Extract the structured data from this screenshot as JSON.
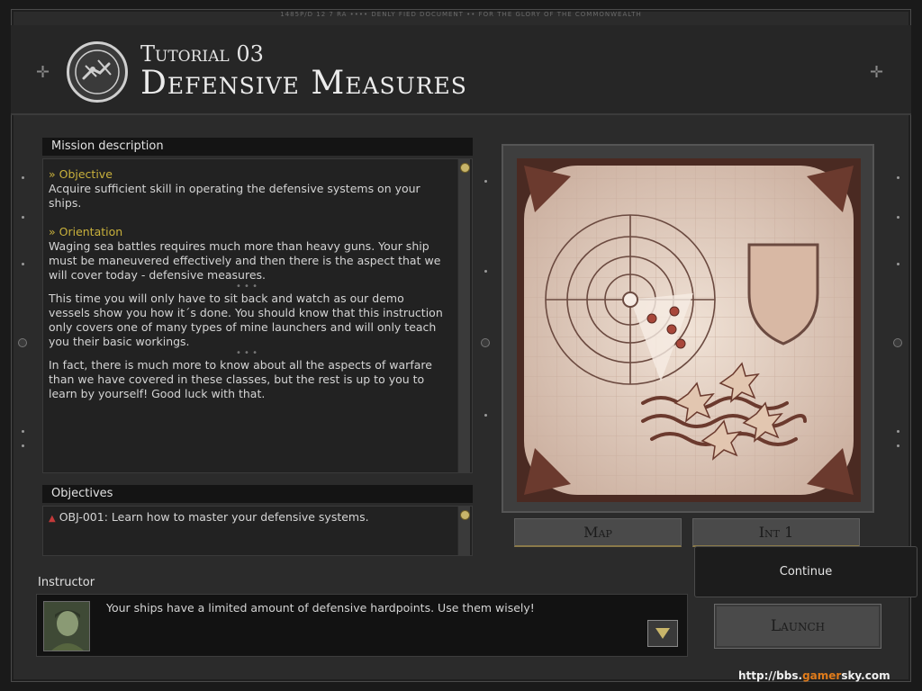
{
  "header": {
    "classified_banner": "1485P/D 12 7 RA •••• DENLY FIED DOCUMENT •• FOR THE GLORY OF THE COMMONWEALTH",
    "tutorial_number": "Tutorial 03",
    "tutorial_title": "Defensive Measures"
  },
  "mission": {
    "heading": "Mission description",
    "objective_label": "» Objective",
    "objective_text": "Acquire sufficient skill in operating the defensive systems on your ships.",
    "orientation_label": "» Orientation",
    "orientation_text": "Waging sea battles requires much more than heavy guns. Your ship must be maneuvered effectively and then there is the aspect that we will cover today - defensive measures.",
    "separator": "• • •",
    "para2": "This time you will only have to sit back and watch as our demo vessels show you how it´s done. You should know that this instruction only covers one of many types of mine launchers and will only teach you their basic workings.",
    "para3": "In fact, there is much more to know about all the aspects of warfare than we have covered in these classes, but the rest is up to you to learn by yourself! Good luck with that."
  },
  "objectives": {
    "heading": "Objectives",
    "bullet": "▲",
    "items": [
      "OBJ-001: Learn how to master your defensive systems."
    ]
  },
  "map_tabs": [
    "Map",
    "Int 1"
  ],
  "instructor": {
    "label": "Instructor",
    "message": "Your ships have a limited amount of defensive hardpoints. Use them wisely!"
  },
  "buttons": {
    "continue": "Continue",
    "launch": "Launch"
  },
  "watermark": {
    "prefix": "http://bbs.",
    "mid": "gamer",
    "suffix": "sky.com"
  },
  "colors": {
    "highlight": "#c9b13c",
    "panel": "#222222",
    "map_paper": "#e8d6c8"
  }
}
